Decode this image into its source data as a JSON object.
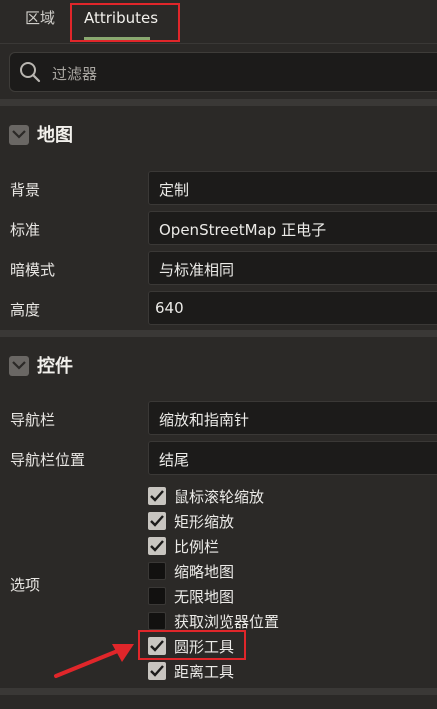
{
  "tabs": [
    {
      "label": "区域"
    },
    {
      "label": "Attributes"
    }
  ],
  "filter": {
    "placeholder": "过滤器"
  },
  "sections": {
    "map": {
      "title": "地图",
      "rows": [
        {
          "label": "背景",
          "value": "定制"
        },
        {
          "label": "标准",
          "value": "OpenStreetMap 正电子"
        },
        {
          "label": "暗模式",
          "value": "与标准相同"
        },
        {
          "label": "高度",
          "value": "640"
        }
      ]
    },
    "controls": {
      "title": "控件",
      "rows": [
        {
          "label": "导航栏",
          "value": "缩放和指南针"
        },
        {
          "label": "导航栏位置",
          "value": "结尾"
        }
      ],
      "options_label": "选项",
      "options": [
        {
          "label": "鼠标滚轮缩放",
          "checked": true
        },
        {
          "label": "矩形缩放",
          "checked": true
        },
        {
          "label": "比例栏",
          "checked": true
        },
        {
          "label": "缩略地图",
          "checked": false
        },
        {
          "label": "无限地图",
          "checked": false
        },
        {
          "label": "获取浏览器位置",
          "checked": false
        },
        {
          "label": "圆形工具",
          "checked": true
        },
        {
          "label": "距离工具",
          "checked": true
        }
      ]
    }
  },
  "colors": {
    "background": "#2b2927",
    "input_bg": "#1c1b1a",
    "tab_accent": "#8aa870",
    "highlight": "#e0262a"
  },
  "icons": {
    "filter": "search-icon",
    "collapse": "chevron-down-icon",
    "checkbox": "check-icon"
  }
}
